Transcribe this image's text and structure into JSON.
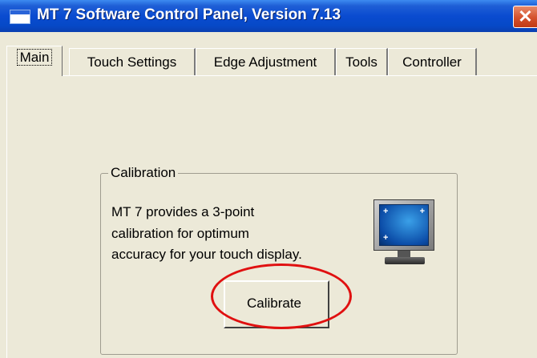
{
  "window": {
    "title": "MT 7 Software Control Panel, Version 7.13",
    "close_glyph": "✕"
  },
  "tabs": [
    {
      "label": "Main",
      "active": true
    },
    {
      "label": "Touch Settings",
      "active": false
    },
    {
      "label": "Edge Adjustment",
      "active": false
    },
    {
      "label": "Tools",
      "active": false
    },
    {
      "label": "Controller",
      "active": false
    }
  ],
  "calibration": {
    "group_label": "Calibration",
    "description_lines": [
      "MT 7 provides a 3-point",
      "calibration for optimum",
      "accuracy for your touch display."
    ],
    "icon": "monitor-calibration-icon",
    "button_label": "Calibrate"
  },
  "colors": {
    "titlebar": "#0a4bd0",
    "window_bg": "#ece9d8",
    "highlight": "#e01010"
  }
}
